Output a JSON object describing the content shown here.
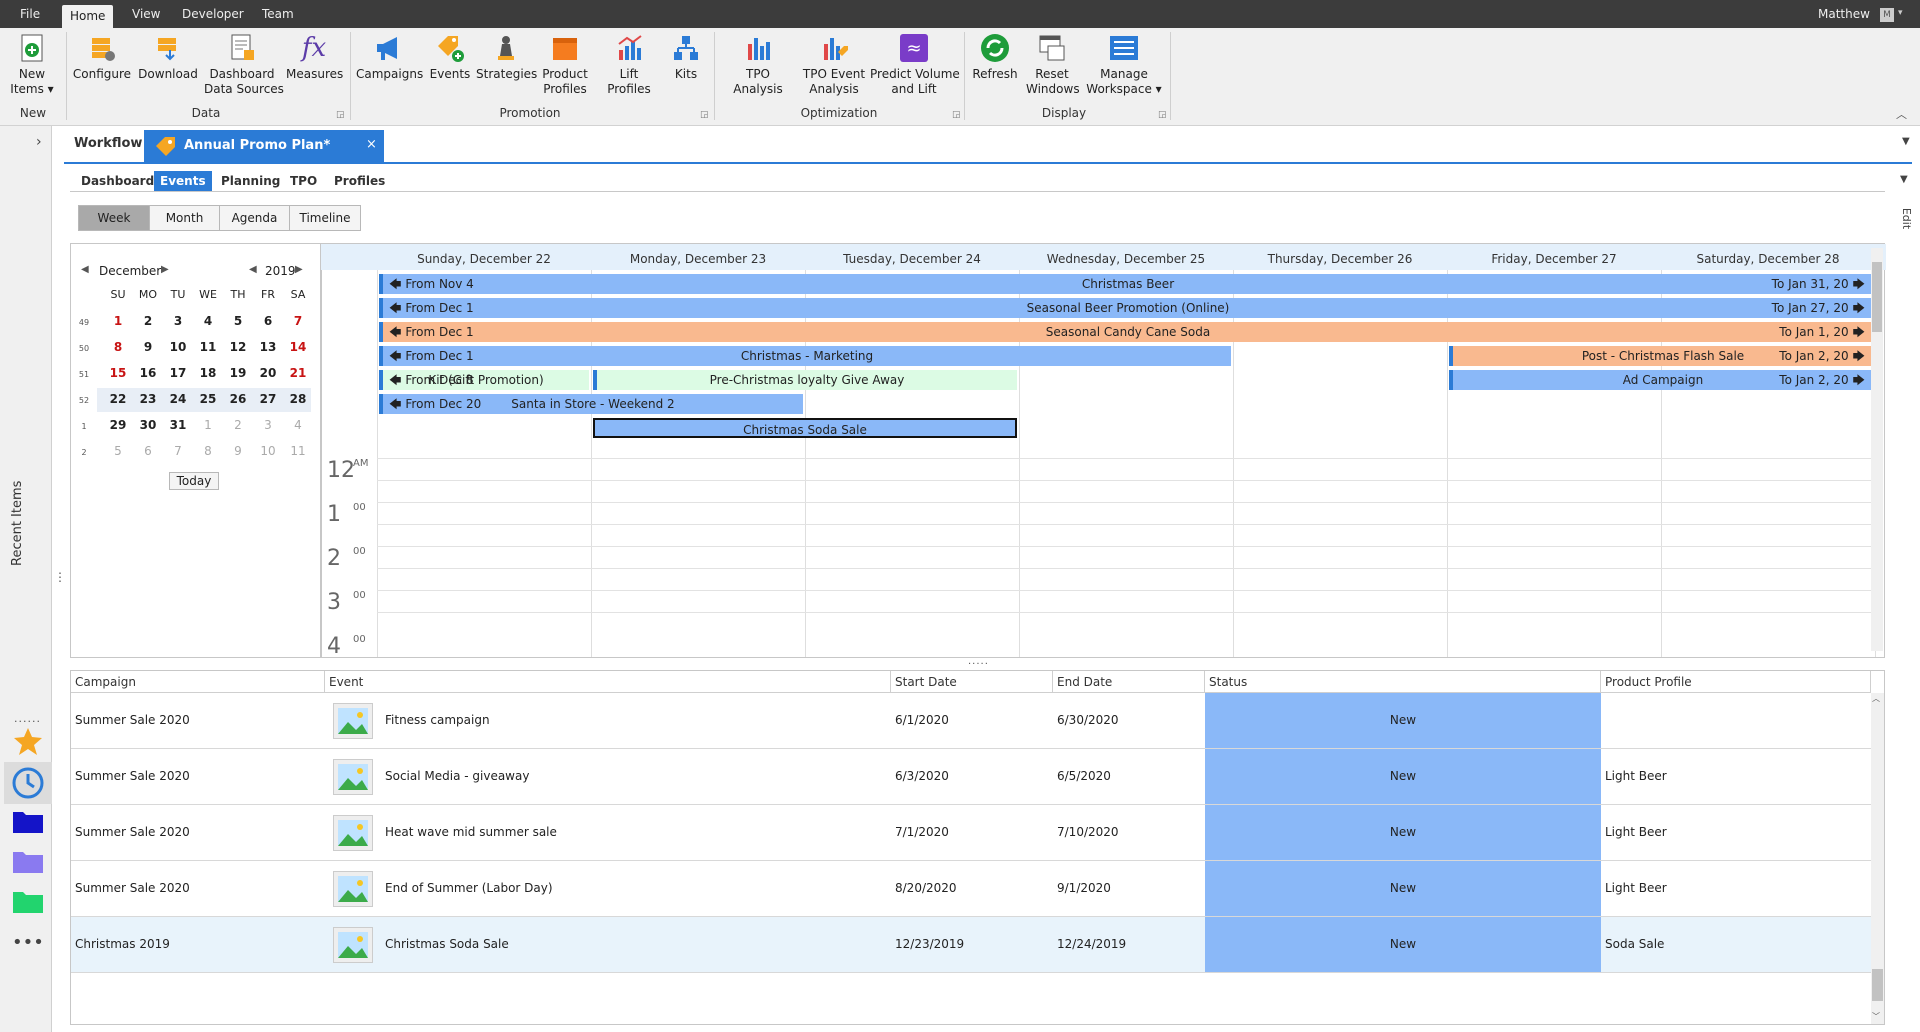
{
  "menubar": {
    "items": [
      "File",
      "Home",
      "View",
      "Developer",
      "Team"
    ],
    "active": "Home",
    "user": "Matthew",
    "user_initial": "M"
  },
  "ribbon": {
    "groups": [
      {
        "label": "New",
        "buttons": [
          {
            "label": "New\nItems ▾"
          }
        ]
      },
      {
        "label": "Data",
        "buttons": [
          {
            "label": "Configure"
          },
          {
            "label": "Download"
          },
          {
            "label": "Dashboard\nData Sources"
          },
          {
            "label": "Measures"
          }
        ]
      },
      {
        "label": "Promotion",
        "buttons": [
          {
            "label": "Campaigns"
          },
          {
            "label": "Events"
          },
          {
            "label": "Strategies"
          },
          {
            "label": "Product\nProfiles"
          },
          {
            "label": "Lift Profiles"
          },
          {
            "label": "Kits"
          }
        ]
      },
      {
        "label": "Optimization",
        "buttons": [
          {
            "label": "TPO Analysis"
          },
          {
            "label": "TPO Event\nAnalysis"
          },
          {
            "label": "Predict Volume\nand Lift"
          }
        ]
      },
      {
        "label": "Display",
        "buttons": [
          {
            "label": "Refresh"
          },
          {
            "label": "Reset\nWindows"
          },
          {
            "label": "Manage\nWorkspace ▾"
          }
        ]
      }
    ]
  },
  "leftrail": {
    "recent_label": "Recent Items"
  },
  "doctabs": {
    "workflow": "Workflow",
    "active": "Annual Promo Plan*"
  },
  "subtabs": [
    "Dashboard",
    "Events",
    "Planning",
    "TPO",
    "Profiles"
  ],
  "subtab_active": "Events",
  "views": [
    "Week",
    "Month",
    "Agenda",
    "Timeline"
  ],
  "view_active": "Week",
  "edit_label": "Edit",
  "minical": {
    "month": "December",
    "year": "2019",
    "weekdays": [
      "SU",
      "MO",
      "TU",
      "WE",
      "TH",
      "FR",
      "SA"
    ],
    "weeks": [
      {
        "num": "49",
        "days": [
          "1",
          "2",
          "3",
          "4",
          "5",
          "6",
          "7"
        ]
      },
      {
        "num": "50",
        "days": [
          "8",
          "9",
          "10",
          "11",
          "12",
          "13",
          "14"
        ]
      },
      {
        "num": "51",
        "days": [
          "15",
          "16",
          "17",
          "18",
          "19",
          "20",
          "21"
        ]
      },
      {
        "num": "52",
        "days": [
          "22",
          "23",
          "24",
          "25",
          "26",
          "27",
          "28"
        ]
      },
      {
        "num": "1",
        "days": [
          "29",
          "30",
          "31",
          "1",
          "2",
          "3",
          "4"
        ]
      },
      {
        "num": "2",
        "days": [
          "5",
          "6",
          "7",
          "8",
          "9",
          "10",
          "11"
        ]
      }
    ],
    "today_label": "Today"
  },
  "week": {
    "days": [
      "Sunday, December 22",
      "Monday, December 23",
      "Tuesday, December 24",
      "Wednesday, December 25",
      "Thursday, December 26",
      "Friday, December 27",
      "Saturday, December 28"
    ],
    "events": [
      {
        "left": "From Nov 4",
        "title": "Christmas Beer",
        "right": "To Jan 31, 20",
        "color": "#8ab8f8"
      },
      {
        "left": "From Dec 1",
        "title": "Seasonal Beer Promotion (Online)",
        "right": "To Jan 27, 20",
        "color": "#8ab8f8"
      },
      {
        "left": "From Dec 1",
        "title": "Seasonal Candy Cane Soda",
        "right": "To Jan 1, 20",
        "color": "#f9b98f"
      },
      {
        "left": "From Dec 1",
        "title": "Christmas - Marketing",
        "right": "",
        "color": "#8ab8f8"
      },
      {
        "left": "",
        "title": "Post - Christmas Flash Sale",
        "right": "To Jan 2, 20",
        "color": "#f9b98f"
      },
      {
        "left": "From Dec 8",
        "title": "Kit (Gift Promotion)",
        "right": "",
        "color": "#dcfbe4"
      },
      {
        "left": "",
        "title": "Pre-Christmas loyalty Give Away",
        "right": "",
        "color": "#dcfbe4"
      },
      {
        "left": "",
        "title": "Ad Campaign",
        "right": "To Jan 2, 20",
        "color": "#8ab8f8"
      },
      {
        "left": "From Dec 20",
        "title": "Santa in Store - Weekend 2",
        "right": "",
        "color": "#8ab8f8"
      },
      {
        "left": "",
        "title": "Christmas Soda Sale",
        "right": "",
        "color": "#8ab8f8"
      }
    ],
    "hours": [
      {
        "h": "12",
        "m": "AM"
      },
      {
        "h": "1",
        "m": "00"
      },
      {
        "h": "2",
        "m": "00"
      },
      {
        "h": "3",
        "m": "00"
      },
      {
        "h": "4",
        "m": "00"
      }
    ]
  },
  "grid": {
    "columns": [
      "Campaign",
      "Event",
      "Start Date",
      "End Date",
      "Status",
      "Product Profile"
    ],
    "rows": [
      {
        "campaign": "Summer Sale 2020",
        "event": "Fitness campaign",
        "start": "6/1/2020",
        "end": "6/30/2020",
        "status": "New",
        "profile": ""
      },
      {
        "campaign": "Summer Sale 2020",
        "event": "Social Media - giveaway",
        "start": "6/3/2020",
        "end": "6/5/2020",
        "status": "New",
        "profile": "Light Beer"
      },
      {
        "campaign": "Summer Sale 2020",
        "event": "Heat wave mid summer sale",
        "start": "7/1/2020",
        "end": "7/10/2020",
        "status": "New",
        "profile": "Light Beer"
      },
      {
        "campaign": "Summer Sale 2020",
        "event": "End of Summer (Labor Day)",
        "start": "8/20/2020",
        "end": "9/1/2020",
        "status": "New",
        "profile": "Light Beer"
      },
      {
        "campaign": "Christmas 2019",
        "event": "Christmas Soda Sale",
        "start": "12/23/2019",
        "end": "12/24/2019",
        "status": "New",
        "profile": "Soda Sale"
      }
    ],
    "selected_row": 4
  }
}
